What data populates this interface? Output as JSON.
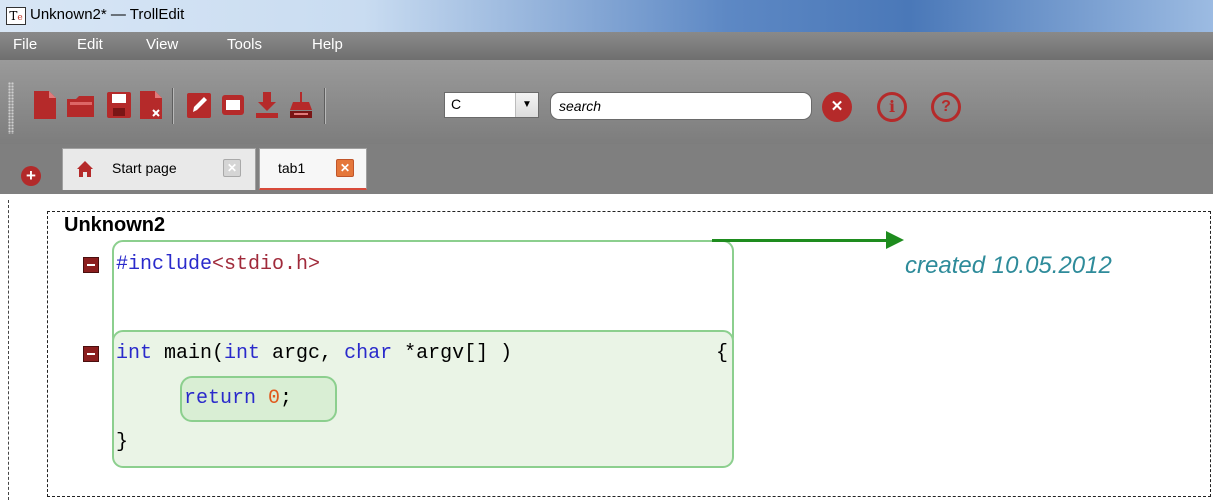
{
  "window": {
    "title": "Unknown2* — TrollEdit",
    "app_icon_label": "T",
    "app_icon_sub": "e"
  },
  "menu": {
    "items": [
      "File",
      "Edit",
      "View",
      "Tools",
      "Help"
    ]
  },
  "toolbar": {
    "buttons": [
      "new-file-icon",
      "open-folder-icon",
      "save-icon",
      "close-file-icon",
      "edit-icon",
      "window-icon",
      "download-icon",
      "print-icon"
    ],
    "language": "C",
    "language_arrow": "▼",
    "search_placeholder": "search",
    "close_glyph": "✕",
    "info_glyph": "i",
    "help_glyph": "?"
  },
  "tabs": {
    "add_glyph": "+",
    "items": [
      {
        "label": "Start page",
        "close_glyph": "✕"
      },
      {
        "label": "tab1",
        "close_glyph": "✕"
      }
    ]
  },
  "editor": {
    "doc_title": "Unknown2",
    "comment": "created 10.05.2012",
    "code": {
      "line1_directive": "#include",
      "line1_header": "<stdio.h>",
      "line2_kw1": "int",
      "line2_a": " main(",
      "line2_kw2": "int",
      "line2_b": " argc, ",
      "line2_kw3": "char",
      "line2_c": " *argv[] )",
      "line2_brace": "{",
      "line3_kw": "return",
      "line3_space": " ",
      "line3_num": "0",
      "line3_semi": ";",
      "line4_brace": "}"
    }
  },
  "colors": {
    "keyword": "#2a2acb",
    "header_string": "#a02a3a",
    "number": "#e05a1e",
    "comment": "#2e8b9a",
    "block_border": "#8ccf8e",
    "arrow": "#1e8c1e"
  }
}
